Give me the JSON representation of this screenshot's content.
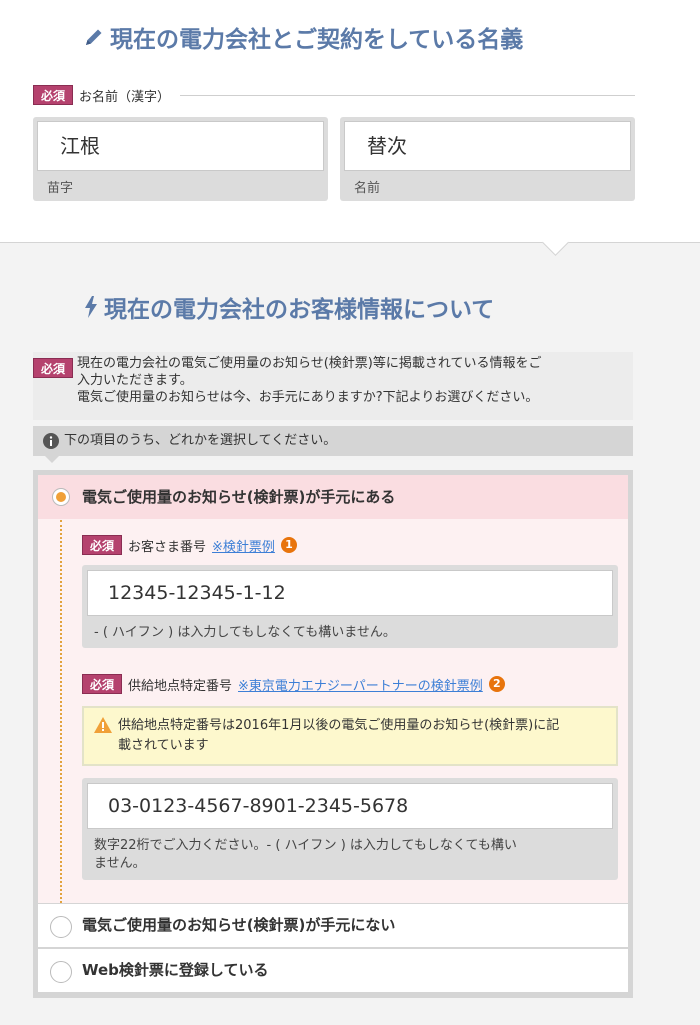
{
  "section1": {
    "title": "現在の電力会社とご契約をしている名義",
    "name_label": "お名前（漢字）",
    "required_badge": "必須",
    "last_name": {
      "value": "江根",
      "caption": "苗字"
    },
    "first_name": {
      "value": "替次",
      "caption": "名前"
    }
  },
  "section2": {
    "title": "現在の電力会社のお客様情報について",
    "required_badge": "必須",
    "description_lines": [
      "現在の電力会社の電気ご使用量のお知らせ(検針票)等に掲載されている情報をご",
      "入力いただきます。",
      "電気ご使用量のお知らせは今、お手元にありますか?下記よりお選びください。"
    ],
    "info_text": "下の項目のうち、どれかを選択してください。",
    "options": [
      {
        "label": "電気ご使用量のお知らせ(検針票)が手元にある",
        "selected": true
      },
      {
        "label": "電気ご使用量のお知らせ(検針票)が手元にない",
        "selected": false
      },
      {
        "label": "Web検針票に登録している",
        "selected": false
      }
    ],
    "customer_number": {
      "badge": "必須",
      "label": "お客さま番号",
      "link": "※検針票例",
      "marker": "1",
      "value": "12345-12345-1-12",
      "note": "- ( ハイフン ) は入力してもしなくても構いません。"
    },
    "supply_point": {
      "badge": "必須",
      "label": "供給地点特定番号",
      "link": "※東京電力エナジーパートナーの検針票例",
      "marker": "2",
      "warning_lines": [
        "供給地点特定番号は2016年1月以後の電気ご使用量のお知らせ(検針票)に記",
        "載されています"
      ],
      "value": "03-0123-4567-8901-2345-5678",
      "note_lines": [
        "数字22桁でご入力ください。- ( ハイフン ) は入力してもしなくても構い",
        "ません。"
      ]
    }
  },
  "colors": {
    "title_blue": "#5b7aa8",
    "badge": "#b5426e",
    "radio_selected": "#f0a038",
    "link": "#3d7fd6",
    "marker": "#e8740c",
    "warning_bg": "#fdf8cd"
  }
}
